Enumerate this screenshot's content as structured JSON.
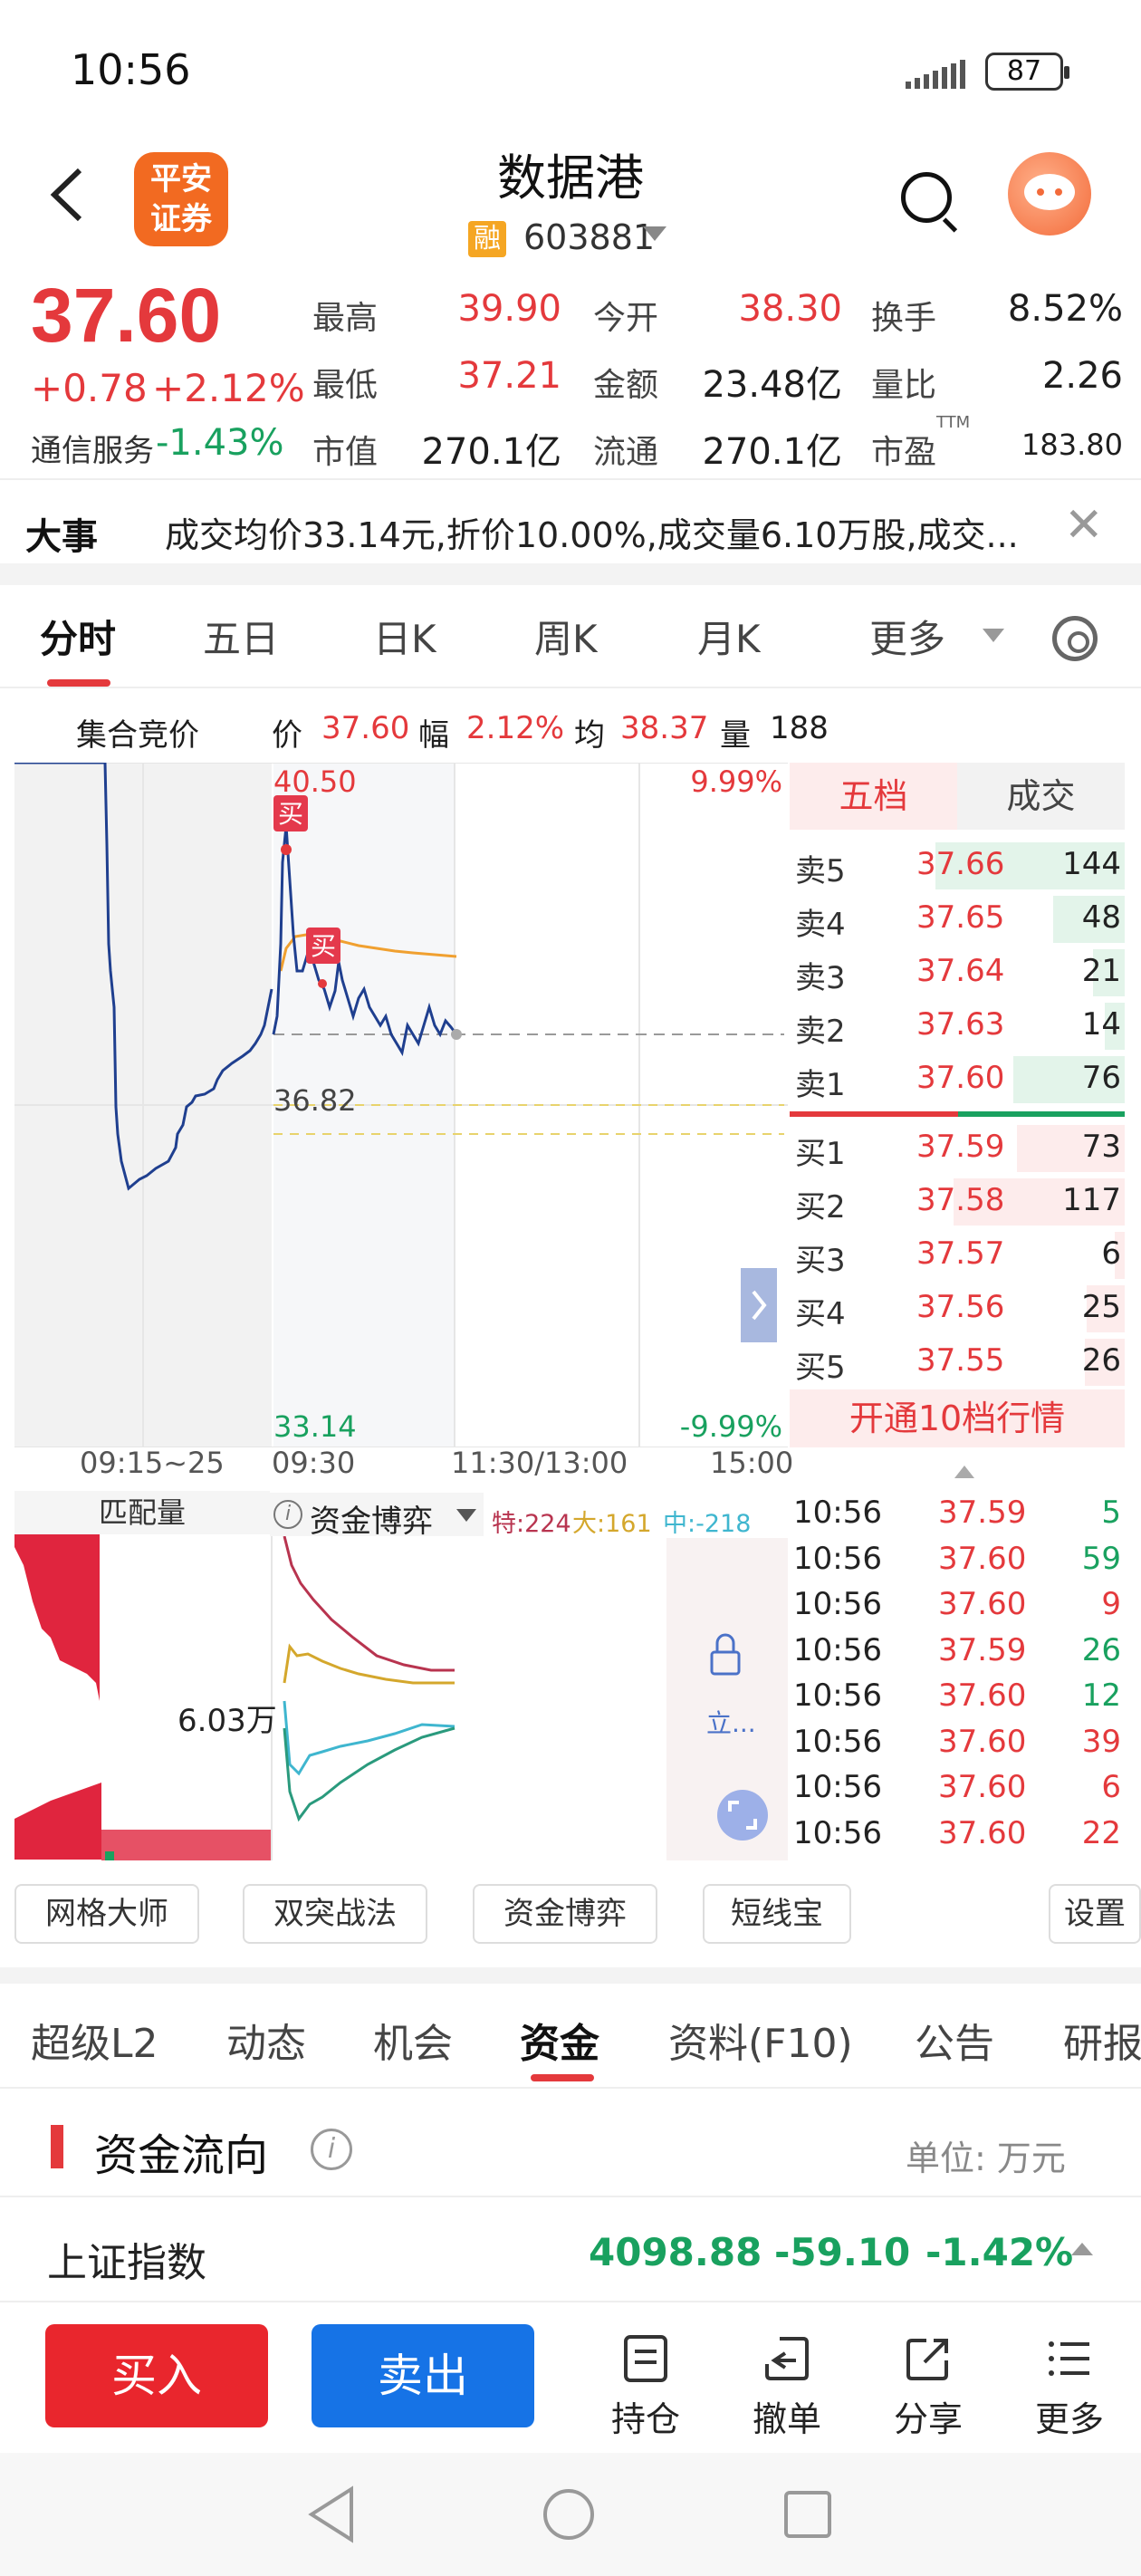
{
  "status_bar": {
    "time": "10:56",
    "battery": "87"
  },
  "header": {
    "logo_text_1": "平安",
    "logo_text_2": "证券",
    "title": "数据港",
    "margin_badge": "融",
    "code": "603881"
  },
  "quote": {
    "price": "37.60",
    "change": "+0.78",
    "change_pct": "+2.12%",
    "sector": "通信服务",
    "sector_pct": "-1.43%",
    "high_label": "最高",
    "high": "39.90",
    "open_label": "今开",
    "open": "38.30",
    "turnover_label": "换手",
    "turnover": "8.52%",
    "low_label": "最低",
    "low": "37.21",
    "amount_label": "金额",
    "amount": "23.48亿",
    "vol_ratio_label": "量比",
    "vol_ratio": "2.26",
    "mcap_label": "市值",
    "mcap": "270.1亿",
    "float_label": "流通",
    "float": "270.1亿",
    "pe_label": "市盈",
    "pe_sup": "TTM",
    "pe": "183.80"
  },
  "news": {
    "label": "大事",
    "text": "成交均价33.14元,折价10.00%,成交量6.10万股,成交..."
  },
  "chart_tabs": [
    "分时",
    "五日",
    "日K",
    "周K",
    "月K",
    "更多"
  ],
  "auction": {
    "label": "集合竞价",
    "price_label": "价",
    "price": "37.60",
    "pct_label": "幅",
    "pct": "2.12%",
    "avg_label": "均",
    "avg": "38.37",
    "vol_label": "量",
    "vol": "188"
  },
  "chart_labels": {
    "top_price": "40.50",
    "top_pct": "9.99%",
    "mid_price": "36.82",
    "bottom_price": "33.14",
    "bottom_pct": "-9.99%",
    "buy_marker": "买",
    "x_ticks": [
      "09:15~25",
      "09:30",
      "11:30/13:00",
      "15:00"
    ]
  },
  "order_book": {
    "tabs": [
      "五档",
      "成交"
    ],
    "asks": [
      {
        "label": "卖5",
        "price": "37.66",
        "vol": "144",
        "bar": 0.95
      },
      {
        "label": "卖4",
        "price": "37.65",
        "vol": "48",
        "bar": 0.36
      },
      {
        "label": "卖3",
        "price": "37.64",
        "vol": "21",
        "bar": 0.16
      },
      {
        "label": "卖2",
        "price": "37.63",
        "vol": "14",
        "bar": 0.1
      },
      {
        "label": "卖1",
        "price": "37.60",
        "vol": "76",
        "bar": 0.56
      }
    ],
    "bids": [
      {
        "label": "买1",
        "price": "37.59",
        "vol": "73",
        "bar": 0.54
      },
      {
        "label": "买2",
        "price": "37.58",
        "vol": "117",
        "bar": 0.86
      },
      {
        "label": "买3",
        "price": "37.57",
        "vol": "6",
        "bar": 0.05
      },
      {
        "label": "买4",
        "price": "37.56",
        "vol": "25",
        "bar": 0.19
      },
      {
        "label": "买5",
        "price": "37.55",
        "vol": "26",
        "bar": 0.2
      }
    ],
    "open_l2": "开通10档行情"
  },
  "lower_panel": {
    "match_label": "匹配量",
    "vol_value": "6.03万",
    "game_label": "资金博弈",
    "special_label": "特:224",
    "big_label": "大:161",
    "mid_label": "中:-218",
    "lock_text": "立..."
  },
  "ticks": [
    {
      "time": "10:56",
      "price": "37.59",
      "vol": "5",
      "dir": "up"
    },
    {
      "time": "10:56",
      "price": "37.60",
      "vol": "59",
      "dir": "up"
    },
    {
      "time": "10:56",
      "price": "37.60",
      "vol": "9",
      "dir": "down"
    },
    {
      "time": "10:56",
      "price": "37.59",
      "vol": "26",
      "dir": "up"
    },
    {
      "time": "10:56",
      "price": "37.60",
      "vol": "12",
      "dir": "up"
    },
    {
      "time": "10:56",
      "price": "37.60",
      "vol": "39",
      "dir": "down"
    },
    {
      "time": "10:56",
      "price": "37.60",
      "vol": "6",
      "dir": "down"
    },
    {
      "time": "10:56",
      "price": "37.60",
      "vol": "22",
      "dir": "down"
    }
  ],
  "tools": [
    "网格大师",
    "双突战法",
    "资金博弈",
    "短线宝",
    "设置"
  ],
  "main_tabs": [
    "超级L2",
    "动态",
    "机会",
    "资金",
    "资料(F10)",
    "公告",
    "研报"
  ],
  "fund_flow": {
    "title": "资金流向",
    "unit": "单位: 万元"
  },
  "index": {
    "name": "上证指数",
    "value": "4098.88",
    "change": "-59.10",
    "pct": "-1.42%"
  },
  "actions": {
    "buy": "买入",
    "sell": "卖出",
    "hold": "持仓",
    "cancel": "撤单",
    "share": "分享",
    "more": "更多"
  }
}
